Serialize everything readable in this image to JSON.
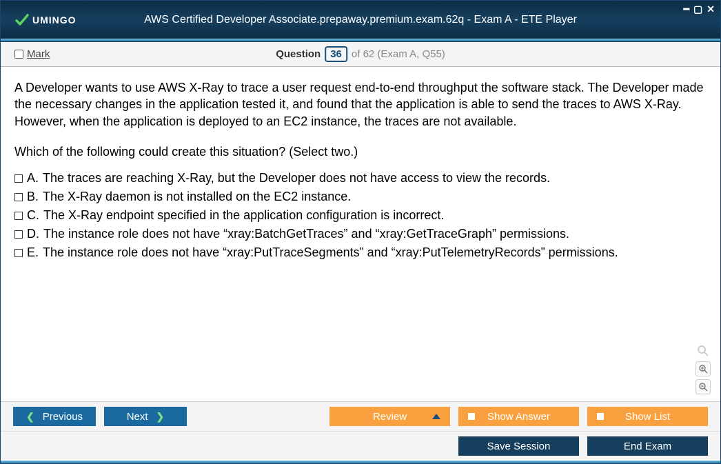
{
  "titlebar": {
    "logo_text": "UMINGO",
    "title": "AWS Certified Developer Associate.prepaway.premium.exam.62q - Exam A - ETE Player"
  },
  "mark": {
    "label": "Mark"
  },
  "question_nav": {
    "label": "Question",
    "current": "36",
    "of_text": "of 62 (Exam A, Q55)"
  },
  "question": {
    "text": "A Developer wants to use AWS X-Ray to trace a user request end-to-end throughput the software stack. The Developer made the necessary changes in the application tested it, and found that the application is able to send the traces to AWS X-Ray. However, when the application is deployed to an EC2 instance, the traces are not available.",
    "sub": "Which of the following could create this situation? (Select two.)"
  },
  "options": [
    {
      "letter": "A.",
      "text": "The traces are reaching X-Ray, but the Developer does not have access to view the records."
    },
    {
      "letter": "B.",
      "text": "The X-Ray daemon is not installed on the EC2 instance."
    },
    {
      "letter": "C.",
      "text": "The X-Ray endpoint specified in the application configuration is incorrect."
    },
    {
      "letter": "D.",
      "text": "The instance role does not have “xray:BatchGetTraces” and “xray:GetTraceGraph” permissions."
    },
    {
      "letter": "E.",
      "text": "The instance role does not have “xray:PutTraceSegments” and “xray:PutTelemetryRecords” permissions."
    }
  ],
  "buttons": {
    "previous": "Previous",
    "next": "Next",
    "review": "Review",
    "show_answer": "Show Answer",
    "show_list": "Show List",
    "save_session": "Save Session",
    "end_exam": "End Exam"
  }
}
